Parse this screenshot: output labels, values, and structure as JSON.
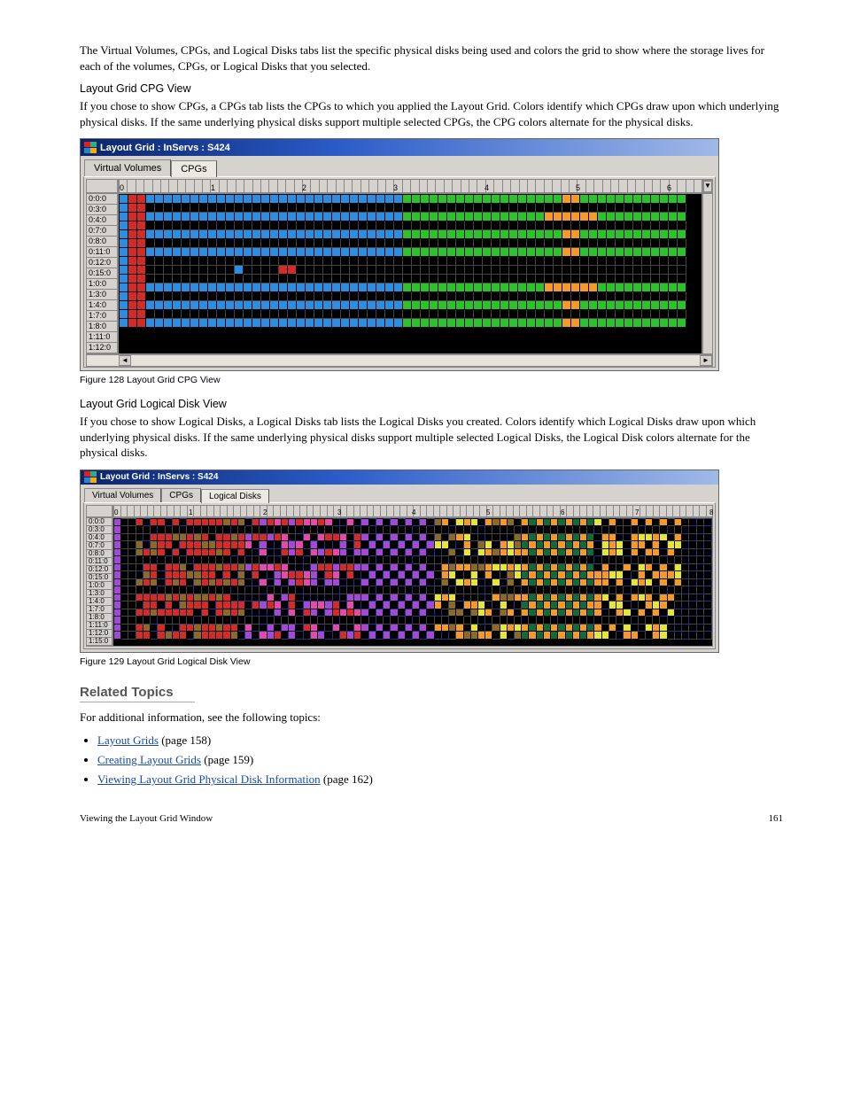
{
  "para1": "The Virtual Volumes, CPGs, and Logical Disks tabs list the specific physical disks being used and colors the grid to show where the storage lives for each of the volumes, CPGs, or Logical Disks that you selected.",
  "group_header": "Layout Grid CPG View",
  "para2": "If you chose to show CPGs, a CPGs tab lists the CPGs to which you applied the Layout Grid. Colors identify which CPGs draw upon which underlying physical disks. If the same underlying physical disks support multiple selected CPGs, the CPG colors alternate for the physical disks.",
  "figA": {
    "title": "Layout Grid : InServs : S424",
    "tabs": [
      "Virtual Volumes",
      "CPGs"
    ],
    "active_tab": "CPGs",
    "col_markers": [
      "0",
      "1",
      "2",
      "3",
      "4",
      "5",
      "6"
    ],
    "rows": [
      "0:0:0",
      "0:3:0",
      "0:4:0",
      "0:7:0",
      "0:8:0",
      "0:11:0",
      "0:12:0",
      "0:15:0",
      "1:0:0",
      "1:3:0",
      "1:4:0",
      "1:7:0",
      "1:8:0",
      "1:11:0",
      "1:12:0"
    ],
    "patternA": [
      "blue",
      "red",
      "red",
      "open",
      "open",
      "open",
      "open",
      "open",
      "open",
      "open",
      "open",
      "open",
      "open",
      "open",
      "open",
      "open",
      "open",
      "open",
      "open",
      "open",
      "open",
      "open",
      "open",
      "open",
      "open",
      "open",
      "open",
      "open",
      "open",
      "open",
      "open",
      "open",
      "open",
      "open",
      "open",
      "open",
      "open",
      "open",
      "open",
      "open",
      "open",
      "open",
      "open",
      "open",
      "open",
      "open",
      "open",
      "open",
      "open",
      "open",
      "open",
      "open",
      "open",
      "open",
      "open",
      "open",
      "open",
      "open",
      "open",
      "open",
      "open",
      "open",
      "open",
      "open"
    ],
    "patternB": [
      "blue",
      "red",
      "red",
      "blue",
      "blue",
      "blue",
      "blue",
      "blue",
      "blue",
      "blue",
      "blue",
      "blue",
      "blue",
      "blue",
      "blue",
      "blue",
      "blue",
      "blue",
      "blue",
      "blue",
      "blue",
      "blue",
      "blue",
      "blue",
      "blue",
      "blue",
      "blue",
      "blue",
      "blue",
      "blue",
      "blue",
      "blue",
      "green",
      "green",
      "green",
      "green",
      "green",
      "green",
      "green",
      "green",
      "green",
      "green",
      "green",
      "green",
      "green",
      "green",
      "green",
      "green",
      "green",
      "green",
      "orange",
      "orange",
      "green",
      "green",
      "green",
      "green",
      "green",
      "green",
      "green",
      "green",
      "green",
      "green",
      "green",
      "green"
    ],
    "patternC": [
      "blue",
      "red",
      "red",
      "blue",
      "blue",
      "blue",
      "blue",
      "blue",
      "blue",
      "blue",
      "blue",
      "blue",
      "blue",
      "blue",
      "blue",
      "blue",
      "blue",
      "blue",
      "blue",
      "blue",
      "blue",
      "blue",
      "blue",
      "blue",
      "blue",
      "blue",
      "blue",
      "blue",
      "blue",
      "blue",
      "blue",
      "blue",
      "green",
      "green",
      "green",
      "green",
      "green",
      "green",
      "green",
      "green",
      "green",
      "green",
      "green",
      "green",
      "green",
      "green",
      "green",
      "green",
      "orange",
      "orange",
      "orange",
      "orange",
      "orange",
      "orange",
      "green",
      "green",
      "green",
      "green",
      "green",
      "green",
      "green",
      "green",
      "green",
      "green"
    ],
    "patternD": [
      "blue",
      "red",
      "red",
      "open",
      "open",
      "open",
      "open",
      "open",
      "open",
      "open",
      "open",
      "open",
      "open",
      "blue",
      "open",
      "open",
      "open",
      "open",
      "red",
      "red",
      "open",
      "open",
      "open",
      "open",
      "open",
      "open",
      "open",
      "open",
      "open",
      "open",
      "open",
      "open",
      "open",
      "open",
      "open",
      "open",
      "open",
      "open",
      "open",
      "open",
      "open",
      "open",
      "open",
      "open",
      "open",
      "open",
      "open",
      "open",
      "open",
      "open",
      "open",
      "open",
      "open",
      "open",
      "open",
      "open",
      "open",
      "open",
      "open",
      "open",
      "open",
      "open",
      "open",
      "open"
    ],
    "order": [
      "B",
      "A",
      "C",
      "A",
      "B",
      "A",
      "B",
      "A",
      "D",
      "A",
      "C",
      "A",
      "B",
      "A",
      "B"
    ]
  },
  "captionA": "Figure 128 Layout Grid CPG View",
  "group_header2": "Layout Grid Logical Disk View",
  "para3": "If you chose to show Logical Disks, a Logical Disks tab lists the Logical Disks you created. Colors identify which Logical Disks draw upon which underlying physical disks. If the same underlying physical disks support multiple selected Logical Disks, the Logical Disk colors alternate for the physical disks.",
  "figB": {
    "title": "Layout Grid : InServs : S424",
    "tabs": [
      "Virtual Volumes",
      "CPGs",
      "Logical Disks"
    ],
    "active_tab": "Logical Disks",
    "col_markers": [
      "0",
      "1",
      "2",
      "3",
      "4",
      "5",
      "6",
      "7",
      "8"
    ],
    "rows": [
      "0:0:0",
      "0:3:0",
      "0:4:0",
      "0:7:0",
      "0:8:0",
      "0:11:0",
      "0:12:0",
      "0:15:0",
      "1:0:0",
      "1:3:0",
      "1:4:0",
      "1:7:0",
      "1:8:0",
      "1:11:0",
      "1:12:0",
      "1:15:0"
    ]
  },
  "captionB": "Figure 129 Layout Grid Logical Disk View",
  "related_title": "Related Topics",
  "related_intro": "For additional information, see the following topics:",
  "links": [
    {
      "label": "Layout Grids",
      "page": "(page 158)"
    },
    {
      "label": "Creating Layout Grids",
      "page": "(page 159)"
    },
    {
      "label": "Viewing Layout Grid Physical Disk Information",
      "page": "(page 162)"
    }
  ],
  "footer_left": "Viewing the Layout Grid Window",
  "footer_right": "161",
  "palette": [
    "blue",
    "red",
    "green",
    "orange",
    "purple",
    "magenta",
    "dkg",
    "cyan",
    "yellow",
    "brown",
    "open",
    "openB"
  ]
}
